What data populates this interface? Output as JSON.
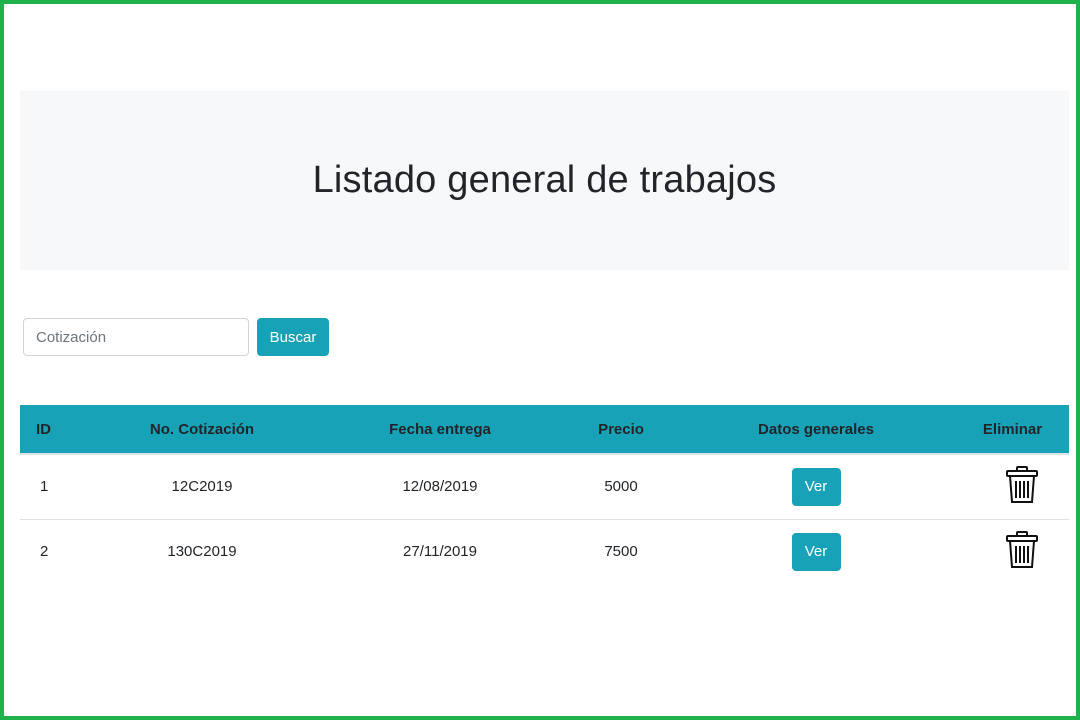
{
  "page": {
    "title": "Listado general de trabajos"
  },
  "search": {
    "placeholder": "Cotización",
    "value": "",
    "button_label": "Buscar"
  },
  "table": {
    "headers": {
      "id": "ID",
      "quote": "No. Cotización",
      "delivery": "Fecha entrega",
      "price": "Precio",
      "general": "Datos generales",
      "delete": "Eliminar"
    },
    "rows": [
      {
        "id": "1",
        "quote": "12C2019",
        "delivery": "12/08/2019",
        "price": "5000",
        "view_label": "Ver",
        "delete_icon": "trash-icon"
      },
      {
        "id": "2",
        "quote": "130C2019",
        "delivery": "27/11/2019",
        "price": "7500",
        "view_label": "Ver",
        "delete_icon": "trash-icon"
      }
    ]
  },
  "colors": {
    "accent": "#17a2b8",
    "frame_border": "#1fb14a",
    "jumbotron_bg": "#f7f8f9"
  }
}
